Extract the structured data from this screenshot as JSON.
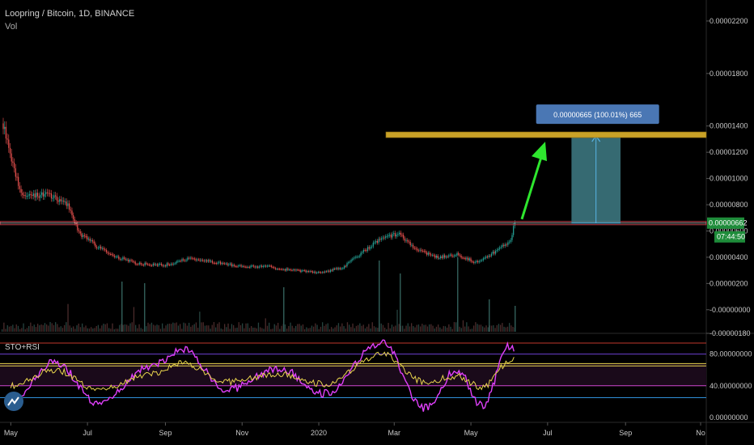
{
  "header": {
    "title": "Loopring / Bitcoin, 1D, BINANCE",
    "volume_label": "Vol"
  },
  "indicator": {
    "label": "STO+RSI",
    "ticks": [
      "80.00000000",
      "40.00000000",
      "0.00000000"
    ]
  },
  "price_axis": {
    "ticks": [
      "0.00002200",
      "0.00001800",
      "0.00001400",
      "0.00001200",
      "0.00001000",
      "0.00000800",
      "0.00000600",
      "0.00000400",
      "0.00000200",
      "-0.00000000",
      "-0.00000180"
    ],
    "current_price": "0.00000662",
    "countdown": "07:44:50"
  },
  "time_axis": {
    "labels": [
      "May",
      "Jul",
      "Sep",
      "Nov",
      "2020",
      "Mar",
      "May",
      "Jul",
      "Sep",
      "No"
    ]
  },
  "measurement": {
    "label": "0.00000665 (100.01%) 665"
  },
  "colors": {
    "background": "#000000",
    "up_candle": "#26a69a",
    "down_candle": "#ef5350",
    "target_line": "#c9a227",
    "support_line": "#c0404a",
    "arrow": "#2ee62e",
    "measure_box": "#3f7d86",
    "measure_label": "#4a77b4",
    "stoch_line": "#e040fb",
    "rsi_line": "#e8d44d"
  },
  "icons": {
    "logo": "tradingview-logo-icon"
  },
  "chart_data": [
    {
      "type": "line",
      "title": "Loopring / Bitcoin, 1D, BINANCE",
      "series": [
        {
          "values": [
            {
              "x": "2019-04-25",
              "y": 1.42e-05
            },
            {
              "x": "2019-05-01",
              "y": 1.18e-05
            },
            {
              "x": "2019-05-10",
              "y": 8.5e-06
            },
            {
              "x": "2019-05-20",
              "y": 8.8e-06
            },
            {
              "x": "2019-06-01",
              "y": 8.7e-06
            },
            {
              "x": "2019-06-15",
              "y": 8e-06
            },
            {
              "x": "2019-06-25",
              "y": 5.8e-06
            },
            {
              "x": "2019-07-10",
              "y": 4.7e-06
            },
            {
              "x": "2019-07-25",
              "y": 4e-06
            },
            {
              "x": "2019-08-10",
              "y": 3.5e-06
            },
            {
              "x": "2019-09-01",
              "y": 3.4e-06
            },
            {
              "x": "2019-09-20",
              "y": 3.9e-06
            },
            {
              "x": "2019-10-10",
              "y": 3.6e-06
            },
            {
              "x": "2019-11-01",
              "y": 3.3e-06
            },
            {
              "x": "2019-11-20",
              "y": 3.3e-06
            },
            {
              "x": "2019-12-10",
              "y": 3e-06
            },
            {
              "x": "2020-01-01",
              "y": 2.8e-06
            },
            {
              "x": "2020-01-20",
              "y": 3.2e-06
            },
            {
              "x": "2020-02-05",
              "y": 4.4e-06
            },
            {
              "x": "2020-02-20",
              "y": 5.5e-06
            },
            {
              "x": "2020-03-05",
              "y": 5.8e-06
            },
            {
              "x": "2020-03-20",
              "y": 4.5e-06
            },
            {
              "x": "2020-04-05",
              "y": 4e-06
            },
            {
              "x": "2020-04-20",
              "y": 4.2e-06
            },
            {
              "x": "2020-05-05",
              "y": 3.6e-06
            },
            {
              "x": "2020-05-20",
              "y": 4.4e-06
            },
            {
              "x": "2020-06-01",
              "y": 5.2e-06
            },
            {
              "x": "2020-06-05",
              "y": 6.6e-06
            }
          ]
        }
      ],
      "ylim": [
        -1.8e-06,
        2.36e-05
      ],
      "levels": {
        "resistance": 1.33e-05,
        "support": 6.6e-06
      },
      "measure": {
        "from": 6.6e-06,
        "to": 1.33e-05,
        "start": "2020-07-20",
        "end": "2020-08-28"
      }
    },
    {
      "type": "line",
      "series": [
        {
          "values": [
            {
              "x": "2019-05-01",
              "y": 20
            },
            {
              "x": "2019-06-05",
              "y": 70
            },
            {
              "x": "2019-07-10",
              "y": 18
            },
            {
              "x": "2019-08-20",
              "y": 65
            },
            {
              "x": "2019-09-15",
              "y": 85
            },
            {
              "x": "2019-10-20",
              "y": 35
            },
            {
              "x": "2019-12-01",
              "y": 62
            },
            {
              "x": "2020-01-05",
              "y": 30
            },
            {
              "x": "2020-02-20",
              "y": 95
            },
            {
              "x": "2020-03-25",
              "y": 12
            },
            {
              "x": "2020-04-20",
              "y": 60
            },
            {
              "x": "2020-05-10",
              "y": 15
            },
            {
              "x": "2020-06-01",
              "y": 90
            },
            {
              "x": "2020-06-05",
              "y": 84
            }
          ]
        },
        {
          "values": [
            {
              "x": "2019-05-01",
              "y": 40
            },
            {
              "x": "2019-06-05",
              "y": 60
            },
            {
              "x": "2019-07-10",
              "y": 35
            },
            {
              "x": "2019-08-20",
              "y": 55
            },
            {
              "x": "2019-09-15",
              "y": 68
            },
            {
              "x": "2019-10-20",
              "y": 45
            },
            {
              "x": "2019-12-01",
              "y": 55
            },
            {
              "x": "2020-01-05",
              "y": 42
            },
            {
              "x": "2020-02-20",
              "y": 80
            },
            {
              "x": "2020-03-25",
              "y": 45
            },
            {
              "x": "2020-04-20",
              "y": 52
            },
            {
              "x": "2020-05-10",
              "y": 38
            },
            {
              "x": "2020-06-01",
              "y": 70
            },
            {
              "x": "2020-06-05",
              "y": 74
            }
          ]
        }
      ],
      "ylim": [
        0,
        100
      ],
      "levels": [
        80,
        68,
        65,
        40,
        25
      ]
    }
  ]
}
